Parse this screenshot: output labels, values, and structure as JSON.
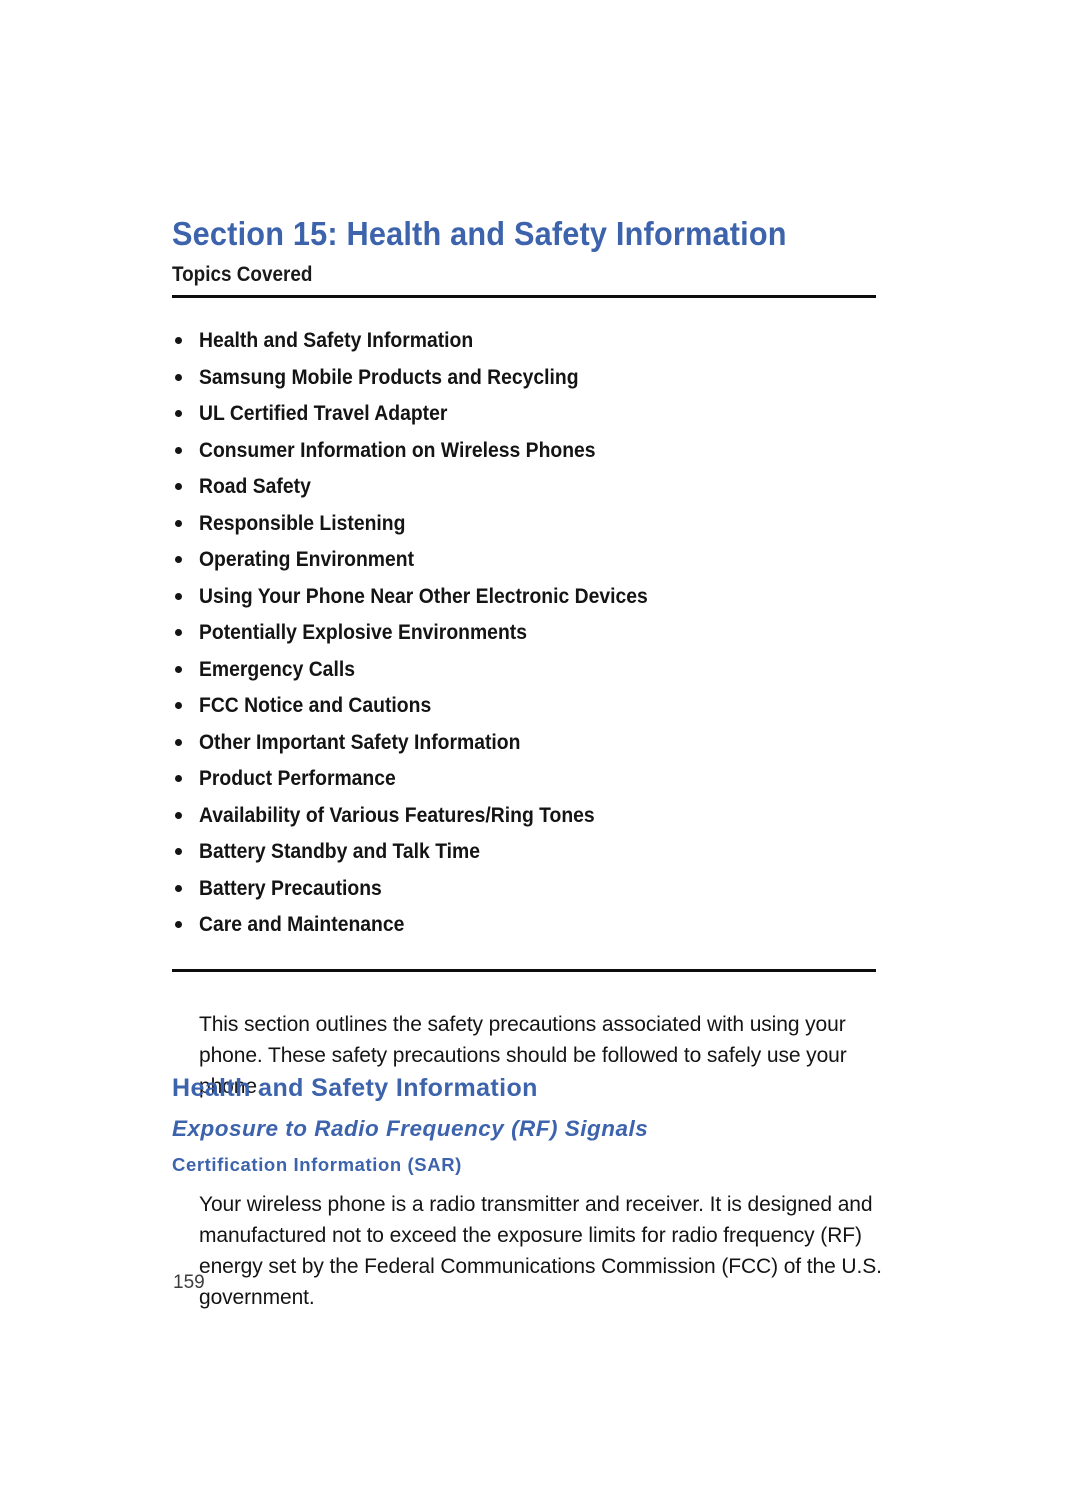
{
  "document": {
    "section_title": "Section 15: Health and Safety Information",
    "topics_label": "Topics Covered",
    "page_number": "159",
    "accent_color": "#3c63ac",
    "rule_color": "#0d0d0d",
    "body_color": "#141414"
  },
  "topics": [
    {
      "label": "Health and Safety Information"
    },
    {
      "label": "Samsung Mobile Products and Recycling"
    },
    {
      "label": "UL Certified Travel Adapter"
    },
    {
      "label": "Consumer Information on Wireless Phones"
    },
    {
      "label": "Road Safety"
    },
    {
      "label": "Responsible Listening"
    },
    {
      "label": "Operating Environment"
    },
    {
      "label": "Using Your Phone Near Other Electronic Devices"
    },
    {
      "label": "Potentially Explosive Environments"
    },
    {
      "label": "Emergency Calls"
    },
    {
      "label": "FCC Notice and Cautions"
    },
    {
      "label": "Other Important Safety Information"
    },
    {
      "label": "Product Performance"
    },
    {
      "label": "Availability of Various Features/Ring Tones"
    },
    {
      "label": "Battery Standby and Talk Time"
    },
    {
      "label": "Battery Precautions"
    },
    {
      "label": "Care and Maintenance"
    }
  ],
  "body": {
    "intro_paragraph": "This section outlines the safety precautions associated with using your phone. These safety precautions should be followed to safely use your phone.",
    "heading_level1": "Health and Safety Information",
    "heading_level2": "Exposure to Radio Frequency (RF) Signals",
    "heading_level3": "Certification Information (SAR)",
    "sar_paragraph": "Your wireless phone is a radio transmitter and receiver. It is designed and manufactured not to exceed the exposure limits for radio frequency (RF) energy set by the Federal Communications Commission (FCC) of the U.S. government."
  }
}
